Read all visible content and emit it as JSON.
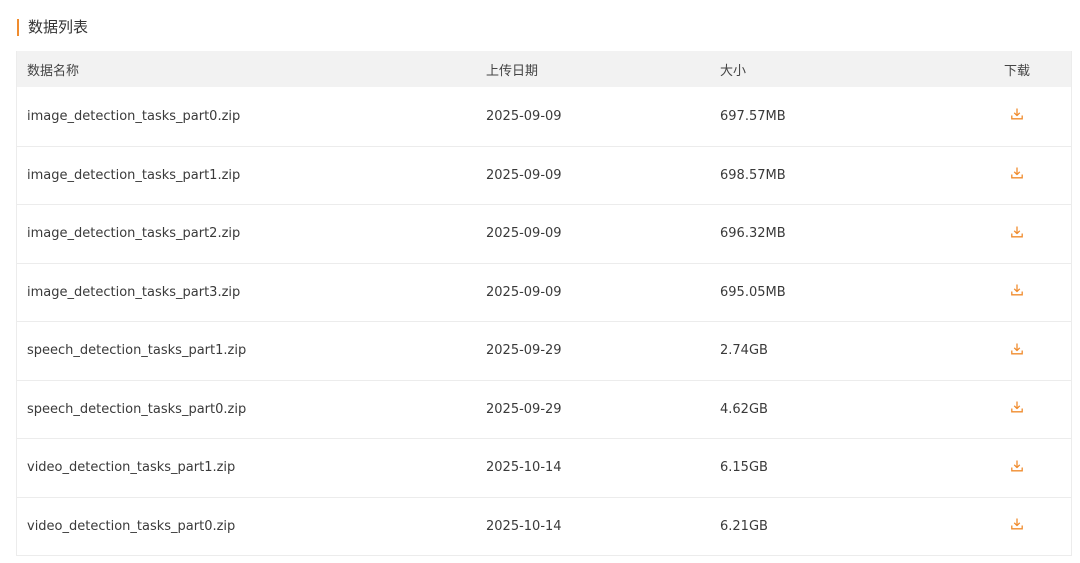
{
  "section": {
    "title": "数据列表"
  },
  "table": {
    "headers": {
      "name": "数据名称",
      "date": "上传日期",
      "size": "大小",
      "download": "下载"
    },
    "rows": [
      {
        "name": "image_detection_tasks_part0.zip",
        "date": "2025-09-09",
        "size": "697.57MB"
      },
      {
        "name": "image_detection_tasks_part1.zip",
        "date": "2025-09-09",
        "size": "698.57MB"
      },
      {
        "name": "image_detection_tasks_part2.zip",
        "date": "2025-09-09",
        "size": "696.32MB"
      },
      {
        "name": "image_detection_tasks_part3.zip",
        "date": "2025-09-09",
        "size": "695.05MB"
      },
      {
        "name": "speech_detection_tasks_part1.zip",
        "date": "2025-09-29",
        "size": "2.74GB"
      },
      {
        "name": "speech_detection_tasks_part0.zip",
        "date": "2025-09-29",
        "size": "4.62GB"
      },
      {
        "name": "video_detection_tasks_part1.zip",
        "date": "2025-10-14",
        "size": "6.15GB"
      },
      {
        "name": "video_detection_tasks_part0.zip",
        "date": "2025-10-14",
        "size": "6.21GB"
      }
    ]
  },
  "icons": {
    "download": "download-icon"
  },
  "colors": {
    "accent": "#f08c2e",
    "header_bg": "#f2f2f2",
    "border": "#ececec"
  }
}
